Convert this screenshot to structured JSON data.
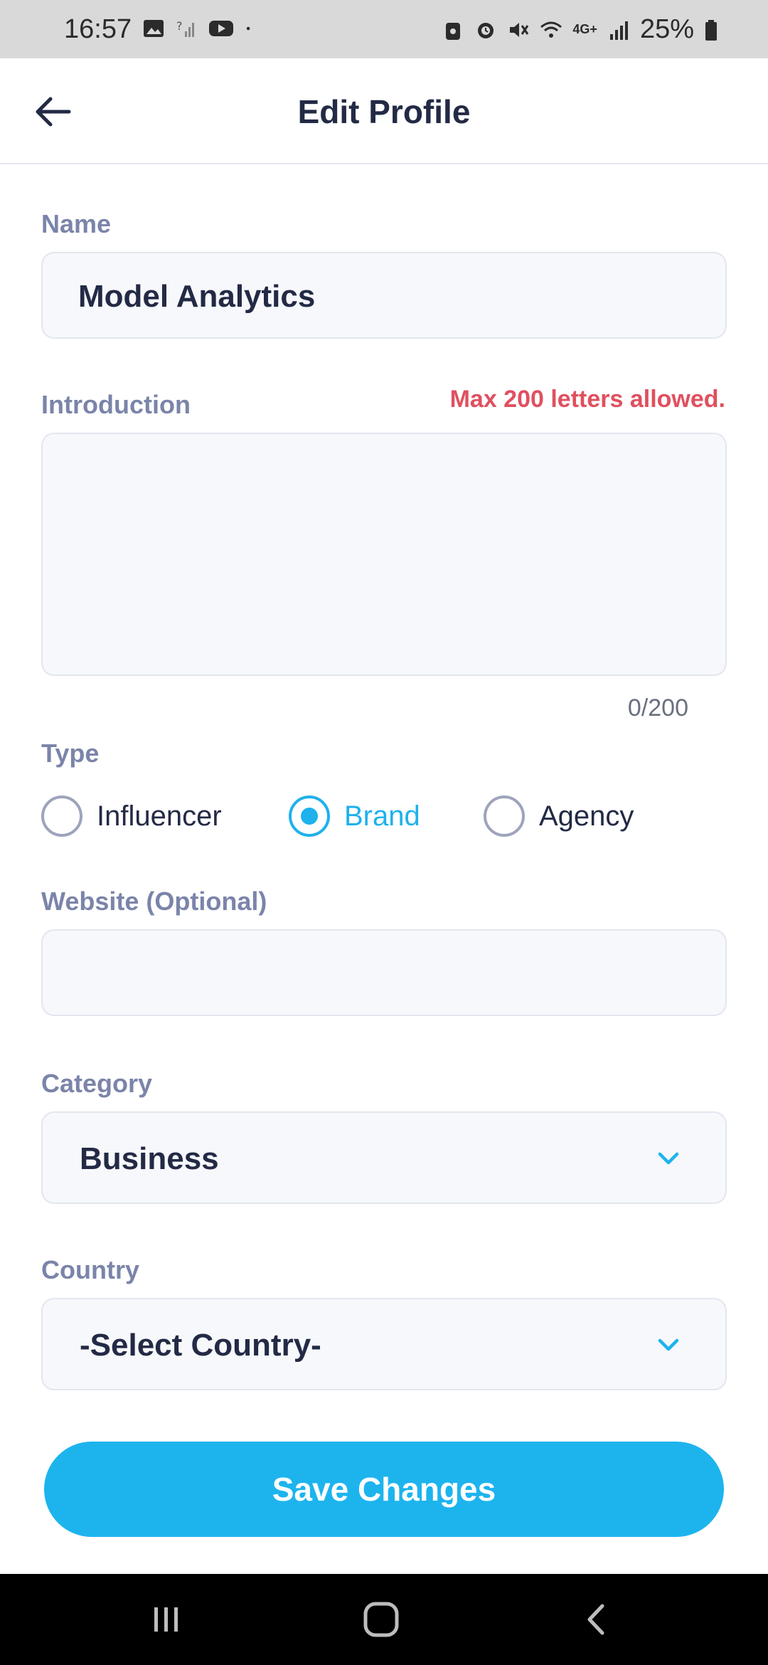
{
  "status_bar": {
    "time": "16:57",
    "battery": "25%",
    "network": "4G+",
    "icons_left": [
      "image-icon",
      "signal-unknown-icon",
      "youtube-icon",
      "dot-icon"
    ],
    "icons_right": [
      "lock-icon",
      "alarm-icon",
      "mute-icon",
      "wifi-icon",
      "data-arrows-icon",
      "signal-icon",
      "battery-icon"
    ]
  },
  "header": {
    "title": "Edit Profile"
  },
  "form": {
    "name_label": "Name",
    "name_value": "Model Analytics",
    "intro_label": "Introduction",
    "intro_warning": "Max 200 letters allowed.",
    "intro_value": "",
    "intro_counter": "0/200",
    "type_label": "Type",
    "type_options": [
      {
        "label": "Influencer",
        "selected": false
      },
      {
        "label": "Brand",
        "selected": true
      },
      {
        "label": "Agency",
        "selected": false
      }
    ],
    "website_label": "Website (Optional)",
    "website_value": "",
    "category_label": "Category",
    "category_value": "Business",
    "country_label": "Country",
    "country_value": "-Select Country-"
  },
  "actions": {
    "save_label": "Save Changes"
  },
  "colors": {
    "accent": "#1db4ee",
    "warning": "#e0505f",
    "label": "#7b84a9",
    "text": "#232a45"
  }
}
